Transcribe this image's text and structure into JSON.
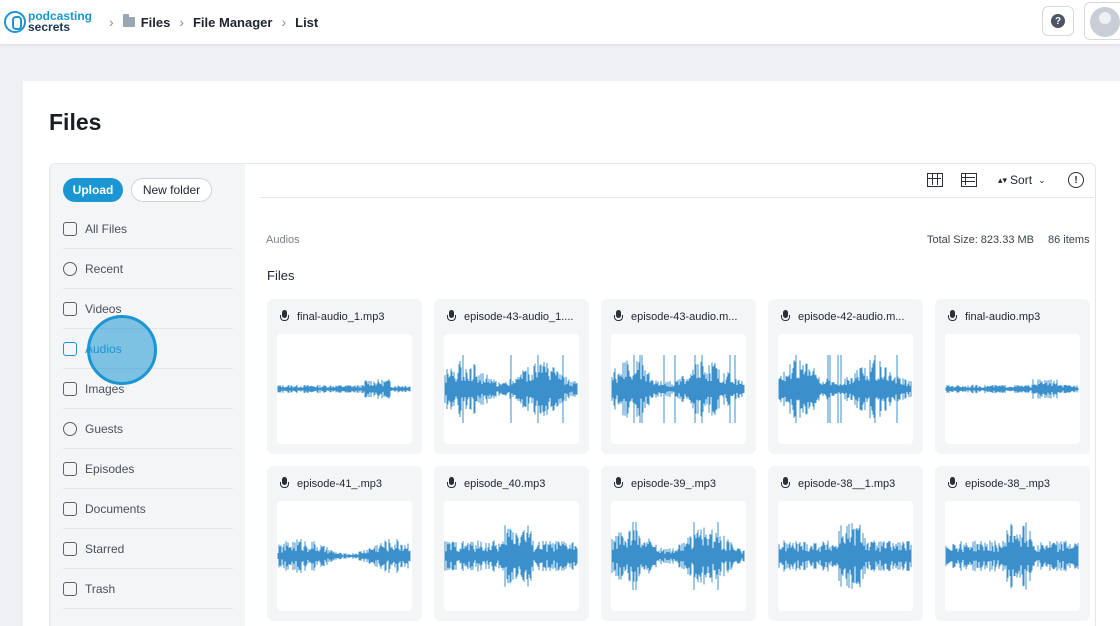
{
  "logo": {
    "line1": "podcasting",
    "line2": "secrets"
  },
  "breadcrumb": [
    {
      "label": "Files",
      "icon": "folder-icon"
    },
    {
      "label": "File Manager"
    },
    {
      "label": "List"
    }
  ],
  "header": {
    "help_label": "?"
  },
  "page": {
    "title": "Files"
  },
  "sidebar": {
    "upload_label": "Upload",
    "new_folder_label": "New folder",
    "items": [
      {
        "label": "All Files",
        "icon": "folder-icon"
      },
      {
        "label": "Recent",
        "icon": "clock-icon"
      },
      {
        "label": "Videos",
        "icon": "video-icon"
      },
      {
        "label": "Audios",
        "icon": "music-icon",
        "active": true
      },
      {
        "label": "Images",
        "icon": "image-icon"
      },
      {
        "label": "Guests",
        "icon": "users-icon"
      },
      {
        "label": "Episodes",
        "icon": "episode-icon"
      },
      {
        "label": "Documents",
        "icon": "document-icon"
      },
      {
        "label": "Starred",
        "icon": "star-icon"
      },
      {
        "label": "Trash",
        "icon": "trash-icon"
      }
    ]
  },
  "toolbar": {
    "sort_label": "Sort",
    "info_label": "!"
  },
  "location": "Audios",
  "summary": {
    "total_size": "Total Size: 823.33 MB",
    "count": "86 items"
  },
  "section_label": "Files",
  "files": [
    {
      "name": "final-audio_1.mp3",
      "style": "quiet"
    },
    {
      "name": "episode-43-audio_1....",
      "style": "loud"
    },
    {
      "name": "episode-43-audio.m...",
      "style": "loud"
    },
    {
      "name": "episode-42-audio.m...",
      "style": "loud"
    },
    {
      "name": "final-audio.mp3",
      "style": "quiet"
    },
    {
      "name": "episode-41_.mp3",
      "style": "medium"
    },
    {
      "name": "episode_40.mp3",
      "style": "burst"
    },
    {
      "name": "episode-39_.mp3",
      "style": "loud"
    },
    {
      "name": "episode-38__1.mp3",
      "style": "burst"
    },
    {
      "name": "episode-38_.mp3",
      "style": "burst"
    }
  ],
  "colors": {
    "accent": "#1b96d3",
    "waveform": "#3b90cc",
    "sidebar_bg": "#f3f5f7"
  }
}
